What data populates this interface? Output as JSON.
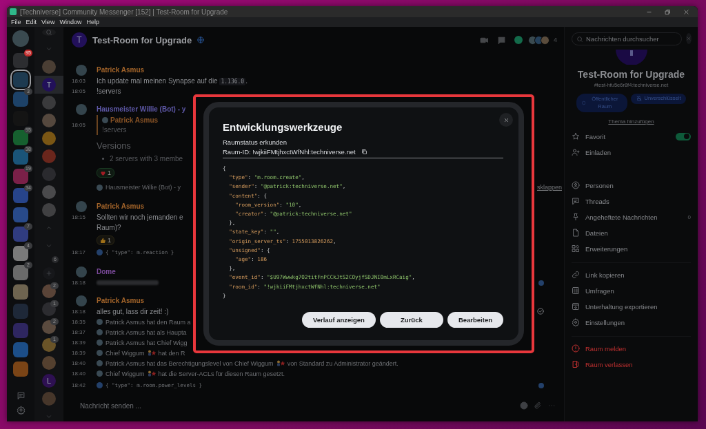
{
  "window": {
    "title": "[Techniverse] Community Messenger [152] | Test-Room for Upgrade"
  },
  "menu": [
    "File",
    "Edit",
    "View",
    "Window",
    "Help"
  ],
  "spaces": [
    {
      "color": "#2c2d30",
      "selected": false,
      "badge": "95",
      "urgent": true
    },
    {
      "color": "#1d3a50",
      "selected": true
    },
    {
      "color": "#1d4268",
      "selected": false,
      "badge": "3",
      "urgent": false
    },
    {
      "color": "#141414",
      "selected": false
    },
    {
      "color": "#16602f",
      "selected": false,
      "badge": "95",
      "urgent": false
    },
    {
      "color": "#1a5478",
      "selected": false,
      "badge": "38",
      "urgent": false
    },
    {
      "color": "#7a2048",
      "selected": false,
      "badge": "19",
      "urgent": false
    },
    {
      "color": "#27448a",
      "selected": false,
      "badge": "34",
      "urgent": false
    },
    {
      "color": "#284a8a",
      "selected": false
    },
    {
      "color": "#303c80",
      "selected": false,
      "badge": "7",
      "urgent": false
    },
    {
      "color": "#7a7a7a",
      "selected": false,
      "badge": "4",
      "urgent": false
    },
    {
      "color": "#6a6a6a",
      "selected": false,
      "badge": "2",
      "urgent": false
    },
    {
      "color": "#6e6450",
      "selected": false
    },
    {
      "color": "#1e2838",
      "selected": false
    },
    {
      "color": "#2e2660",
      "selected": false
    },
    {
      "color": "#1c4e88",
      "selected": false
    },
    {
      "color": "#7a4416",
      "selected": false
    }
  ],
  "rooms": [
    {
      "kind": "collapse"
    },
    {
      "kind": "room",
      "color": "#4a3e34",
      "selected": false
    },
    {
      "kind": "room",
      "color": "#22105a",
      "letter": "T",
      "selected": true
    },
    {
      "kind": "room",
      "color": "#3a3a3c",
      "selected": false
    },
    {
      "kind": "room",
      "color": "#55483e",
      "selected": false
    },
    {
      "kind": "room",
      "color": "#7a5614",
      "selected": false
    },
    {
      "kind": "room",
      "color": "#6a261c",
      "selected": false
    },
    {
      "kind": "room",
      "color": "#2a2a2e",
      "selected": false
    },
    {
      "kind": "room",
      "color": "#4a4a4c",
      "selected": false
    },
    {
      "kind": "room",
      "color": "#404042",
      "selected": false
    },
    {
      "kind": "expand"
    },
    {
      "kind": "collapse"
    },
    {
      "kind": "count",
      "badge": "6"
    },
    {
      "kind": "add"
    },
    {
      "kind": "room",
      "color": "#5a4438",
      "badge": "2",
      "selected": false
    },
    {
      "kind": "room",
      "color": "#2c2c30",
      "badge": "1",
      "selected": false
    },
    {
      "kind": "room",
      "color": "#5a4a3e",
      "badge": "2",
      "selected": false
    },
    {
      "kind": "room",
      "color": "#6a5428",
      "badge": "1",
      "selected": false
    },
    {
      "kind": "room",
      "color": "#54402f",
      "selected": false
    },
    {
      "kind": "room",
      "color": "#2e1052",
      "letter": "L",
      "selected": false
    },
    {
      "kind": "room",
      "color": "#46362a",
      "selected": false
    },
    {
      "kind": "collapse"
    }
  ],
  "room": {
    "letter": "T",
    "name": "Test-Room for Upgrade",
    "member_count": "4"
  },
  "timeline": [
    {
      "kind": "sender",
      "name": "Patrick Asmus",
      "color": "#a3642a"
    },
    {
      "kind": "text",
      "time": "18:03",
      "text": "Ich update mal meinen Synapse auf die ",
      "code": "1.136.0",
      "after": "."
    },
    {
      "kind": "text",
      "time": "18:05",
      "text": "!servers"
    },
    {
      "kind": "sender",
      "name": "Hausmeister Willie (Bot) - y",
      "color": "#5e58a8"
    },
    {
      "kind": "quote",
      "time": "18:05",
      "name": "Patrick Asmus",
      "text": "!servers"
    },
    {
      "kind": "heading",
      "text": "Versions"
    },
    {
      "kind": "bullet",
      "text": "2 servers with 3 membe"
    },
    {
      "kind": "love",
      "count": "1"
    },
    {
      "kind": "receipt",
      "text": "Hausmeister Willie (Bot) - y",
      "link": "sklappen"
    },
    {
      "kind": "sender",
      "name": "Patrick Asmus",
      "color": "#a3642a"
    },
    {
      "kind": "text",
      "time": "18:15",
      "text": "Sollten wir noch jemanden e"
    },
    {
      "kind": "text",
      "text": "Raum)?"
    },
    {
      "kind": "like",
      "count": "1"
    },
    {
      "kind": "code",
      "time": "18:17",
      "text": "{ \"type\": m.reaction }"
    },
    {
      "kind": "sender",
      "name": "Dome",
      "color": "#7a4a9a"
    },
    {
      "kind": "blurred",
      "time": "18:18",
      "read": true
    },
    {
      "kind": "sender",
      "name": "Patrick Asmus",
      "color": "#a3642a"
    },
    {
      "kind": "text",
      "time": "18:18",
      "text": "alles gut, lass dir zeit! :)",
      "sent": true
    },
    {
      "kind": "system",
      "time": "18:35",
      "text": "Patrick Asmus hat den Raum a"
    },
    {
      "kind": "system",
      "time": "18:37",
      "text": "Patrick Asmus hat als Haupta"
    },
    {
      "kind": "system",
      "time": "18:39",
      "text": "Patrick Asmus hat Chief Wigg"
    },
    {
      "kind": "system",
      "time": "18:39",
      "text": "Chief Wiggum",
      "emoji": true,
      "after": "hat den R"
    },
    {
      "kind": "system",
      "time": "18:40",
      "text": "Patrick Asmus hat das Berechtigungslevel von Chief Wiggum",
      "emoji": true,
      "after": "von Standard zu Administrator geändert."
    },
    {
      "kind": "system",
      "time": "18:40",
      "text": "Chief Wiggum",
      "emoji": true,
      "after": "hat die Server-ACLs für diesen Raum gesetzt."
    },
    {
      "kind": "code",
      "time": "18:42",
      "text": "{ \"type\": m.room.power_levels }",
      "read": true
    }
  ],
  "composer": {
    "placeholder": "Nachricht senden ..."
  },
  "dialog": {
    "title": "Entwicklungswerkzeuge",
    "subtitle": "Raumstatus erkunden",
    "room_id": "Raum-ID: !wjkiiFMtjhxctWfNhl:techniverse.net",
    "code": [
      "{",
      "  \"type\": \"m.room.create\",",
      "  \"sender\": \"@patrick:techniverse.net\",",
      "  \"content\": {",
      "    \"room_version\": \"10\",",
      "    \"creator\": \"@patrick:techniverse.net\"",
      "  },",
      "  \"state_key\": \"\",",
      "  \"origin_server_ts\": 1755013826262,",
      "  \"unsigned\": {",
      "    \"age\": 186",
      "  },",
      "  \"event_id\": \"$U97Wwwkg7O2titFnPCCkJtS2COyjfSDJNI0mLxRCaig\",",
      "  \"room_id\": \"!wjkiiFMtjhxctWfNhl:techniverse.net\"",
      "}"
    ],
    "buttons": [
      "Verlauf anzeigen",
      "Zurück",
      "Bearbeiten"
    ]
  },
  "right_panel": {
    "search": {
      "placeholder": "Nachrichten durchsucher"
    },
    "name": "Test-Room for Upgrade",
    "alias": "#test-hfu5e6r8f4:techniverse.net",
    "badges": [
      {
        "kind": "public",
        "label": "Öffentlicher Raum"
      },
      {
        "kind": "unencrypted",
        "label": "Unverschlüsselt"
      }
    ],
    "topic_link": "Thema hinzufügen",
    "groups": [
      [
        {
          "kind": "star",
          "label": "Favorit",
          "on": true
        },
        {
          "kind": "invite",
          "label": "Einladen"
        }
      ],
      [
        {
          "kind": "people",
          "label": "Personen"
        },
        {
          "kind": "threads",
          "label": "Threads"
        },
        {
          "kind": "pin",
          "label": "Angeheftete Nachrichten",
          "count": "0"
        },
        {
          "kind": "file",
          "label": "Dateien"
        },
        {
          "kind": "extensions",
          "label": "Erweiterungen"
        }
      ],
      [
        {
          "kind": "link",
          "label": "Link kopieren"
        },
        {
          "kind": "poll",
          "label": "Umfragen"
        },
        {
          "kind": "export",
          "label": "Unterhaltung exportieren"
        },
        {
          "kind": "settings",
          "label": "Einstellungen"
        }
      ],
      [
        {
          "kind": "report",
          "label": "Raum melden",
          "danger": true
        },
        {
          "kind": "leave",
          "label": "Raum verlassen",
          "danger": true
        }
      ]
    ]
  }
}
